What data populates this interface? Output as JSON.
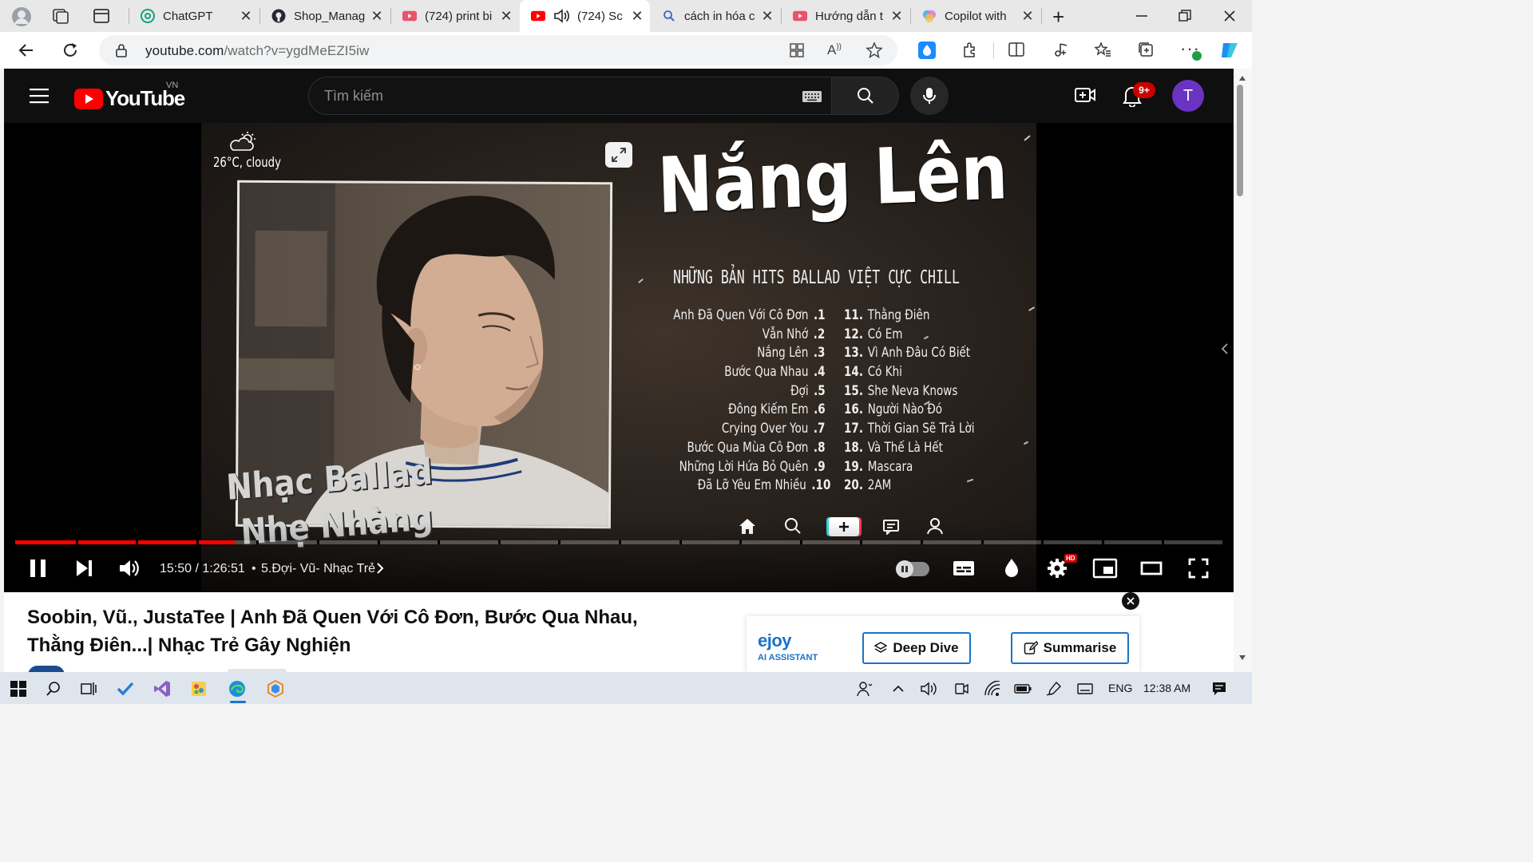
{
  "browser": {
    "tabs": [
      {
        "title": "ChatGPT"
      },
      {
        "title": "Shop_Manag"
      },
      {
        "title": "(724) print bi"
      },
      {
        "title": "(724) Sc"
      },
      {
        "title": "cách in hóa c"
      },
      {
        "title": "Hướng dẫn t"
      },
      {
        "title": "Copilot with"
      }
    ],
    "url_host": "youtube.com",
    "url_path": "/watch?v=ygdMeEZI5iw",
    "new_tab": "+"
  },
  "youtube": {
    "logo": "YouTube",
    "country": "VN",
    "search_placeholder": "Tìm kiếm",
    "notif_count": "9+",
    "avatar_letter": "T"
  },
  "video": {
    "weather": "26°C, cloudy",
    "big_title": "Nắng Lên",
    "subtitle": "NHỮNG BẢN HITS BALLAD VIỆT CỰC CHILL",
    "tracks_left": [
      {
        "title": "Anh Đã Quen Với Cô Đơn",
        "num": ".1"
      },
      {
        "title": "Vẫn Nhớ",
        "num": ".2"
      },
      {
        "title": "Nắng Lên",
        "num": ".3"
      },
      {
        "title": "Bước Qua Nhau",
        "num": ".4"
      },
      {
        "title": "Đợi",
        "num": ".5"
      },
      {
        "title": "Đông Kiếm Em",
        "num": ".6"
      },
      {
        "title": "Crying Over You",
        "num": ".7"
      },
      {
        "title": "Bước Qua Mùa Cô Đơn",
        "num": ".8"
      },
      {
        "title": "Những Lời Hứa Bỏ Quên",
        "num": ".9"
      },
      {
        "title": "Đã Lỡ Yêu Em Nhiều",
        "num": ".10"
      }
    ],
    "tracks_right": [
      {
        "num": "11.",
        "title": "Thằng Điên"
      },
      {
        "num": "12.",
        "title": "Có Em"
      },
      {
        "num": "13.",
        "title": "Vì Anh Đâu Có Biết"
      },
      {
        "num": "14.",
        "title": "Có Khi"
      },
      {
        "num": "15.",
        "title": "She Neva Knows"
      },
      {
        "num": "16.",
        "title": "Người Nào Đó"
      },
      {
        "num": "17.",
        "title": "Thời Gian Sẽ Trả Lời"
      },
      {
        "num": "18.",
        "title": "Và Thế Là Hết"
      },
      {
        "num": "19.",
        "title": "Mascara"
      },
      {
        "num": "20.",
        "title": "2AM"
      }
    ],
    "overlay_line1": "Nhạc Ballad",
    "overlay_line2": "Nhẹ Nhàng",
    "time": "15:50 / 1:26:51",
    "chapter": "5.Đợi- Vũ- Nhạc Trẻ",
    "hd_badge": "HD",
    "progress": 0.182,
    "title": "Soobin, Vũ., JustaTee | Anh Đã Quen Với Cô Đơn, Bước Qua Nhau, Thằng Điên...| Nhạc Trẻ Gây Nghiện"
  },
  "ejoy": {
    "brand": "ejoy",
    "brand_sub": "AI ASSISTANT",
    "deep_dive": "Deep Dive",
    "summarise": "Summarise"
  },
  "taskbar": {
    "language": "ENG",
    "clock": "12:38 AM"
  },
  "colors": {
    "yt_red": "#ff0000",
    "ejoy_blue": "#1a73c8",
    "avatar_purple": "#6a33c2"
  }
}
